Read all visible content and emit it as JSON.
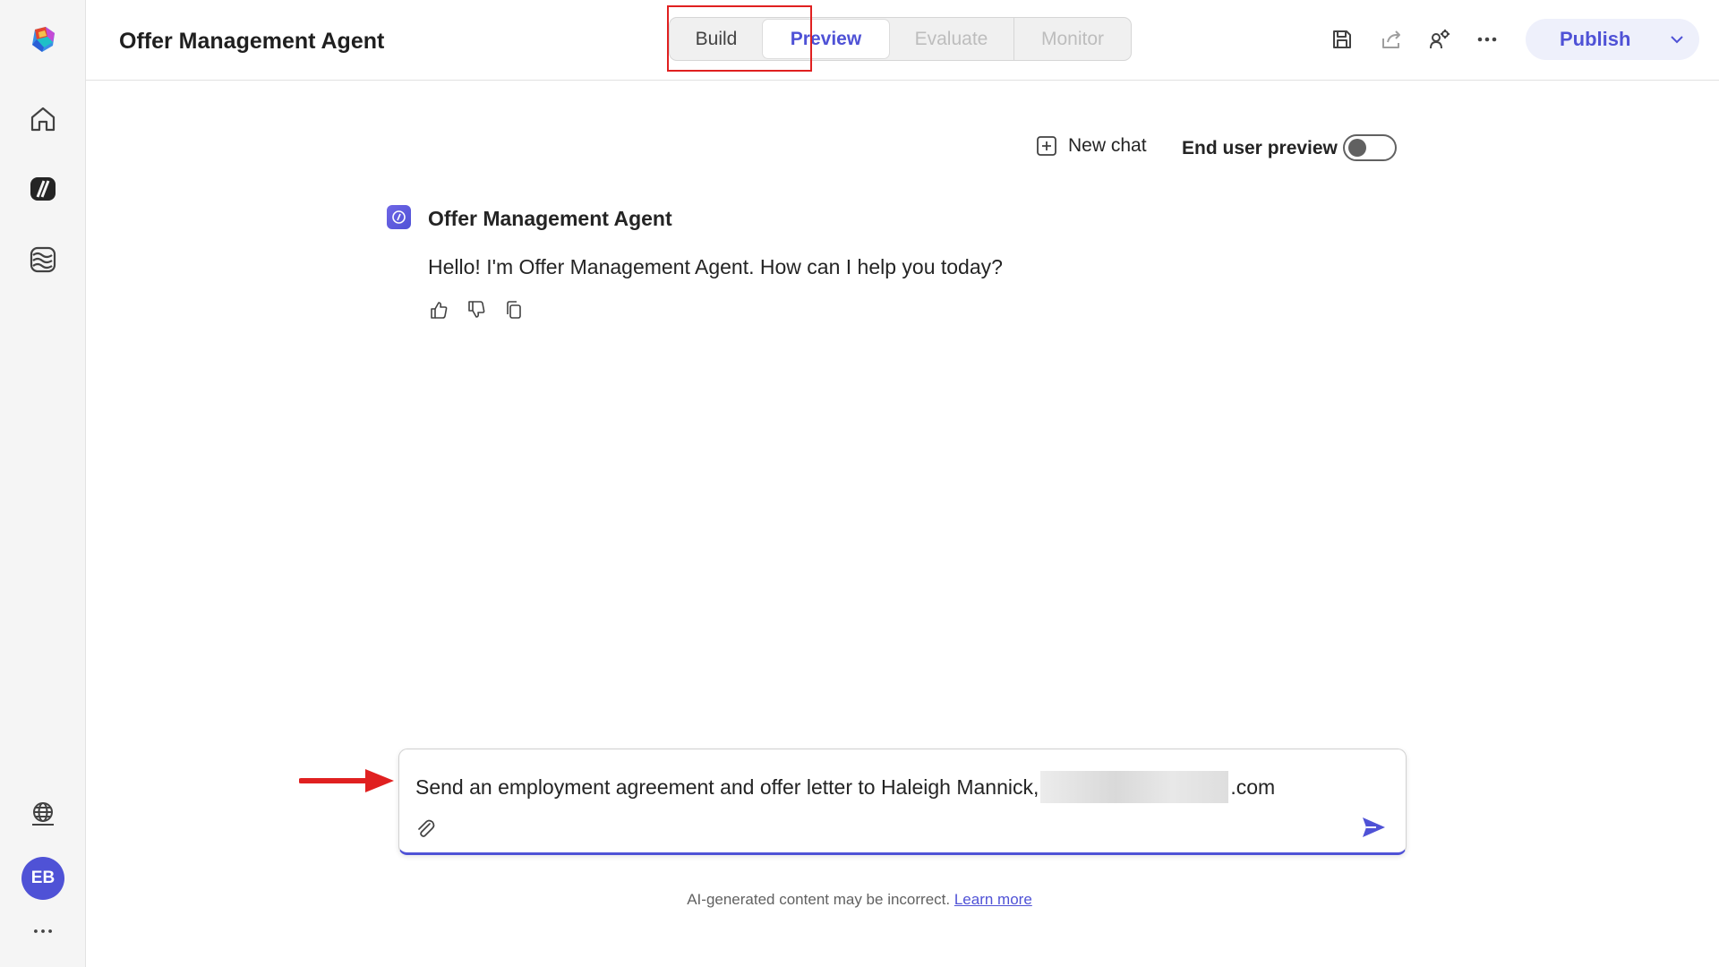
{
  "app": {
    "title": "Offer Management Agent"
  },
  "tabs": [
    {
      "label": "Build",
      "state": "normal"
    },
    {
      "label": "Preview",
      "state": "selected"
    },
    {
      "label": "Evaluate",
      "state": "disabled"
    },
    {
      "label": "Monitor",
      "state": "disabled"
    }
  ],
  "header_icons": [
    "save-icon",
    "share-icon",
    "people-settings-icon",
    "more-icon"
  ],
  "publish": {
    "label": "Publish"
  },
  "sidebar": {
    "items": [
      "home-icon",
      "agents-icon",
      "knowledge-icon"
    ],
    "bottom_items": [
      "globe-icon"
    ],
    "avatar_initials": "EB"
  },
  "toolbar": {
    "new_chat_label": "New chat",
    "end_user_preview_label": "End user preview",
    "end_user_preview_on": false
  },
  "message": {
    "sender": "Offer Management Agent",
    "text": "Hello! I'm Offer Management Agent. How can I help you today?"
  },
  "composer": {
    "text_before": "Send an employment agreement and offer letter to Haleigh Mannick,",
    "text_after": ".com"
  },
  "footer": {
    "disclaimer": "AI-generated content may be incorrect.",
    "learn_more": "Learn more"
  },
  "colors": {
    "accent": "#4f52d6",
    "highlight_box": "#e02020",
    "rail_bg": "#f5f5f5"
  }
}
